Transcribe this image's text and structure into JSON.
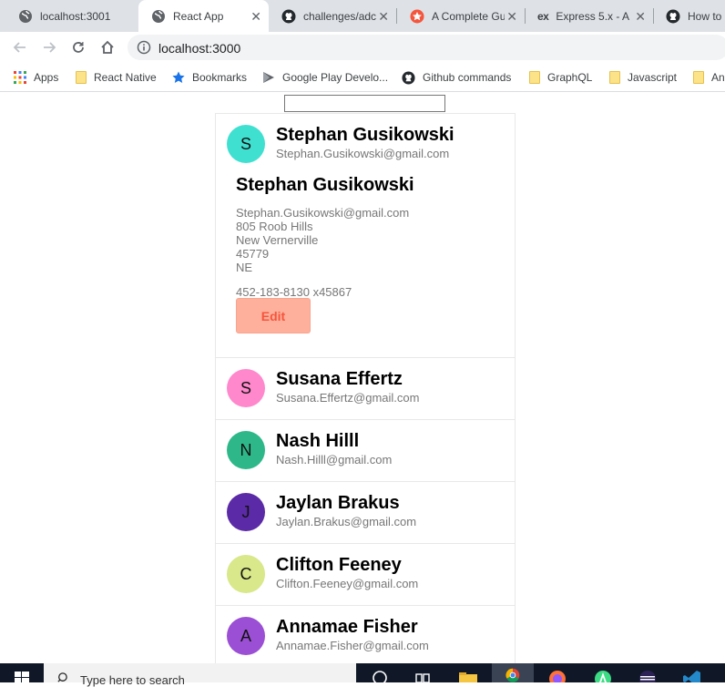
{
  "browser": {
    "tabs": [
      {
        "label": "localhost:3001",
        "favicon": "globe-icon",
        "active": false
      },
      {
        "label": "React App",
        "favicon": "globe-icon",
        "active": true
      },
      {
        "label": "challenges/adc",
        "favicon": "github-icon",
        "active": false
      },
      {
        "label": "A Complete Gu",
        "favicon": "star-icon",
        "active": false
      },
      {
        "label": "Express 5.x - A",
        "favicon": "ex",
        "active": false
      },
      {
        "label": "How to",
        "favicon": "github-icon",
        "active": false
      }
    ],
    "url": "localhost:3000",
    "bookmarks": [
      {
        "label": "Apps",
        "icon": "apps-grid-icon"
      },
      {
        "label": "React Native",
        "icon": "folder-icon"
      },
      {
        "label": "Bookmarks",
        "icon": "star-icon"
      },
      {
        "label": "Google Play Develo...",
        "icon": "play-icon"
      },
      {
        "label": "Github commands",
        "icon": "github-icon"
      },
      {
        "label": "GraphQL",
        "icon": "folder-icon"
      },
      {
        "label": "Javascript",
        "icon": "folder-icon"
      },
      {
        "label": "An",
        "icon": "folder-icon"
      }
    ]
  },
  "app": {
    "search_value": "",
    "expanded": {
      "initial": "S",
      "color": "#40e0d0",
      "name": "Stephan Gusikowski",
      "email": "Stephan.Gusikowski@gmail.com",
      "detail_name": "Stephan Gusikowski",
      "detail_lines": [
        "Stephan.Gusikowski@gmail.com",
        "805 Roob Hills",
        "New Vernerville",
        "45779",
        "NE"
      ],
      "phone": "452-183-8130 x45867",
      "edit_label": "Edit"
    },
    "contacts": [
      {
        "initial": "S",
        "color": "#ff88cc",
        "name": "Susana Effertz",
        "email": "Susana.Effertz@gmail.com"
      },
      {
        "initial": "N",
        "color": "#2eb88a",
        "name": "Nash Hilll",
        "email": "Nash.Hilll@gmail.com"
      },
      {
        "initial": "J",
        "color": "#5b2aa6",
        "name": "Jaylan Brakus",
        "email": "Jaylan.Brakus@gmail.com"
      },
      {
        "initial": "C",
        "color": "#d8e88a",
        "name": "Clifton Feeney",
        "email": "Clifton.Feeney@gmail.com"
      },
      {
        "initial": "A",
        "color": "#9a4fd4",
        "name": "Annamae Fisher",
        "email": "Annamae.Fisher@gmail.com"
      }
    ]
  },
  "taskbar": {
    "search_placeholder": "Type here to search"
  }
}
